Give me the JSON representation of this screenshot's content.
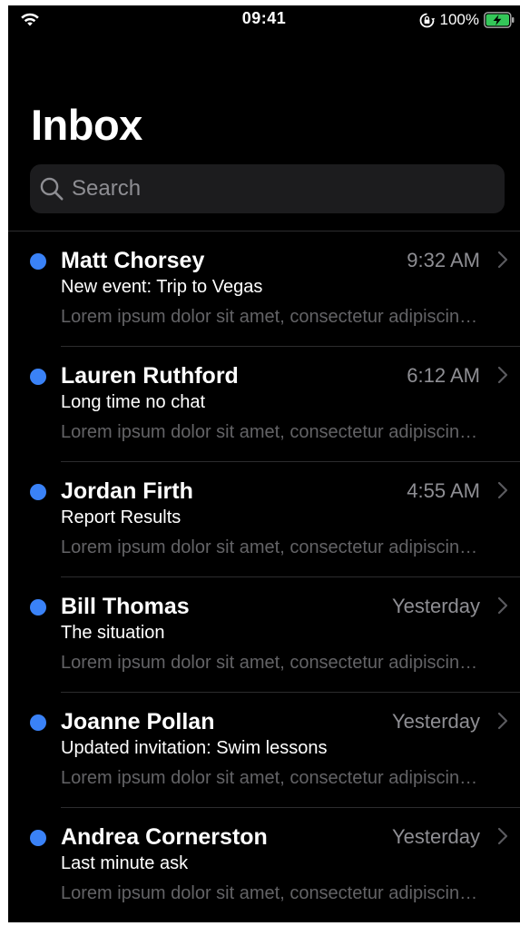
{
  "status_bar": {
    "time": "09:41",
    "battery_percent": "100%",
    "icons": [
      "wifi-icon",
      "orientation-lock-icon",
      "battery-charging-icon"
    ]
  },
  "header": {
    "title": "Inbox"
  },
  "search": {
    "placeholder": "Search",
    "value": ""
  },
  "colors": {
    "background": "#000000",
    "unread_dot": "#3a82f7",
    "secondary_text": "#8e8e93",
    "preview_text": "#636366",
    "battery_green": "#34c759"
  },
  "messages": [
    {
      "sender": "Matt Chorsey",
      "time": "9:32 AM",
      "subject": "New event: Trip to Vegas",
      "preview": "Lorem ipsum dolor sit amet, consectetur adipiscing elit",
      "unread": true
    },
    {
      "sender": "Lauren Ruthford",
      "time": "6:12 AM",
      "subject": "Long time no chat",
      "preview": "Lorem ipsum dolor sit amet, consectetur adipiscing elit",
      "unread": true
    },
    {
      "sender": "Jordan Firth",
      "time": "4:55 AM",
      "subject": "Report Results",
      "preview": "Lorem ipsum dolor sit amet, consectetur adipiscing elit",
      "unread": true
    },
    {
      "sender": "Bill Thomas",
      "time": "Yesterday",
      "subject": "The situation",
      "preview": "Lorem ipsum dolor sit amet, consectetur adipiscing elit",
      "unread": true
    },
    {
      "sender": "Joanne Pollan",
      "time": "Yesterday",
      "subject": "Updated invitation: Swim lessons",
      "preview": "Lorem ipsum dolor sit amet, consectetur adipiscing elit",
      "unread": true
    },
    {
      "sender": "Andrea Cornerston",
      "time": "Yesterday",
      "subject": "Last minute ask",
      "preview": "Lorem ipsum dolor sit amet, consectetur adipiscing elit",
      "unread": true
    }
  ]
}
